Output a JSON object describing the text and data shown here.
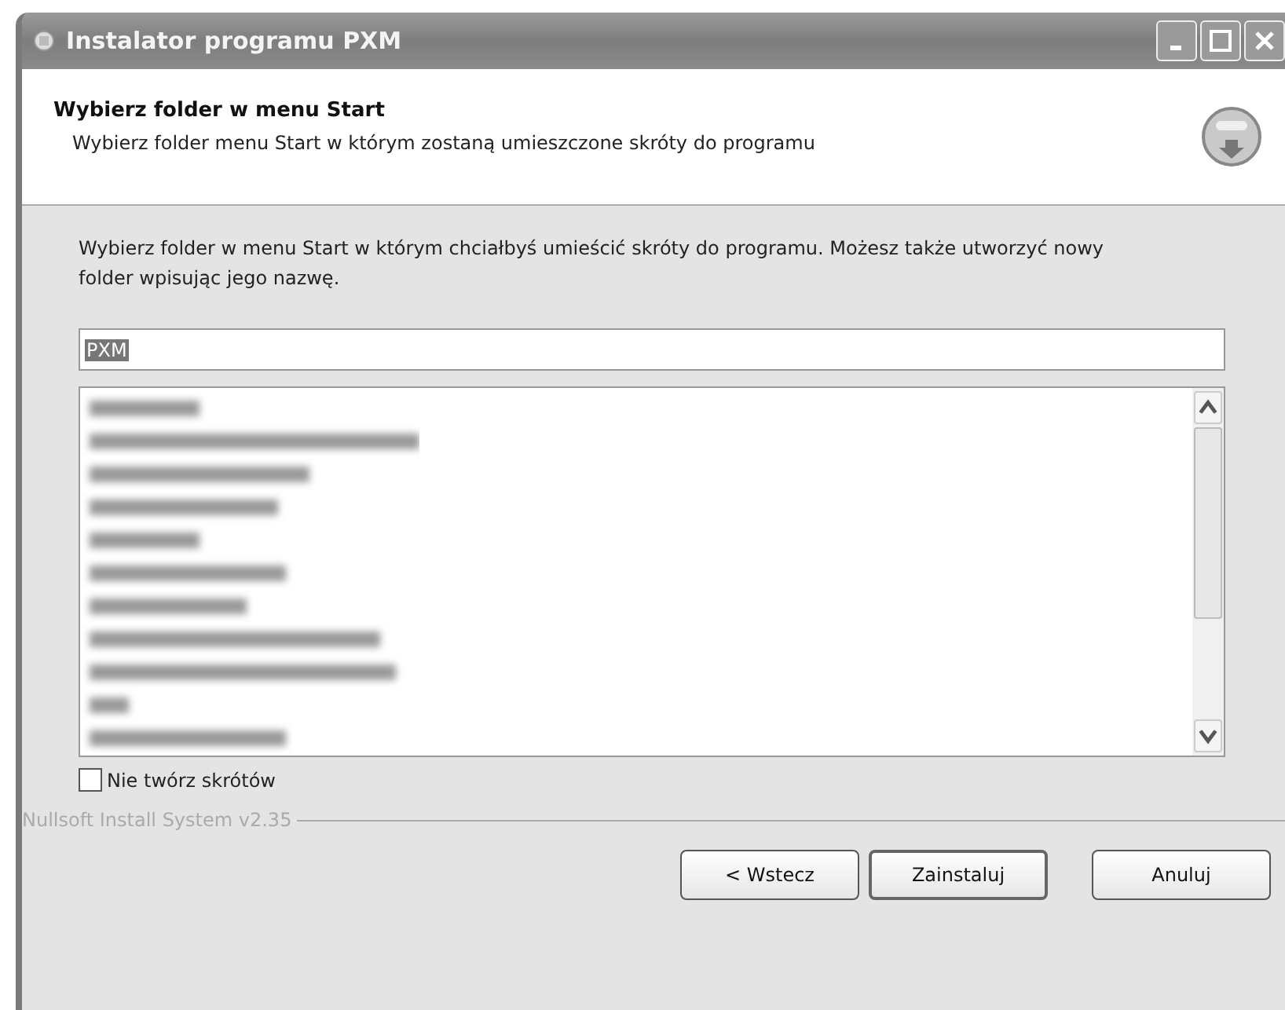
{
  "window": {
    "title": "Instalator programu PXM"
  },
  "header": {
    "title": "Wybierz folder w menu Start",
    "subtitle": "Wybierz folder menu Start w którym zostaną umieszczone skróty do programu"
  },
  "description": "Wybierz folder w menu Start w którym chciałbyś umieścić skróty do programu. Możesz także utworzyć nowy folder wpisując jego nazwę.",
  "folder_field": {
    "value": "PXM"
  },
  "checkbox": {
    "label": "Nie twórz skrótów",
    "checked": false
  },
  "branding": "Nullsoft Install System v2.35",
  "buttons": [
    {
      "label": "< Wstecz",
      "default": false
    },
    {
      "label": "Zainstaluj",
      "default": true
    },
    {
      "label": "Anuluj",
      "default": false
    }
  ]
}
